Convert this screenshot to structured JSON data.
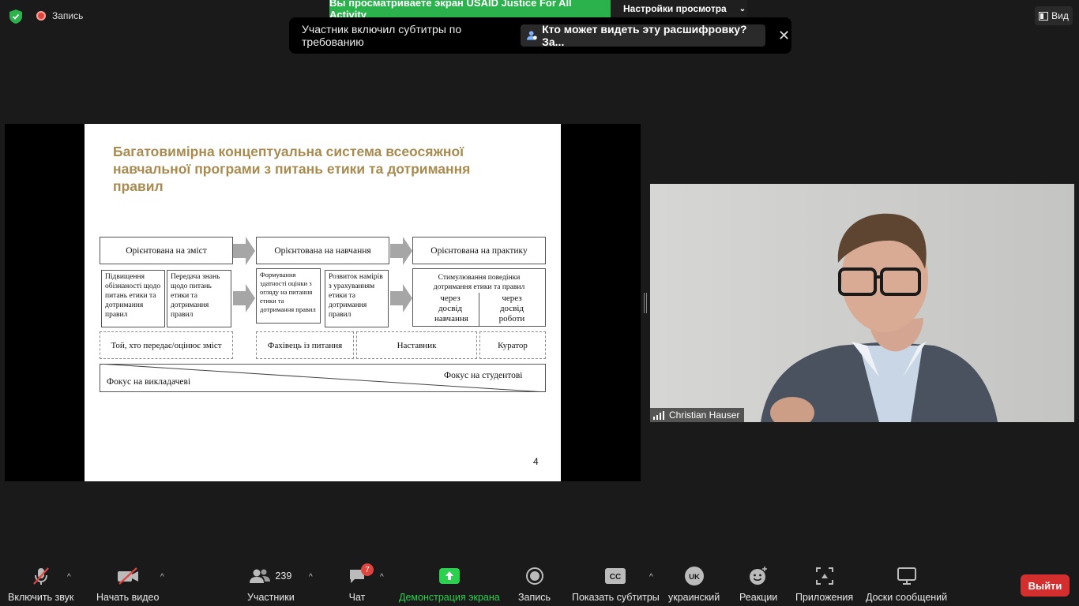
{
  "top": {
    "recording_label": "Запись",
    "share_banner": "Вы просматриваете экран USAID Justice For All Activity",
    "view_options": "Настройки просмотра",
    "view_button": "Вид"
  },
  "caption_notice": {
    "text": "Участник включил субтитры по требованию",
    "link": "Кто может видеть эту расшифровку? За..."
  },
  "slide": {
    "title": "Багатовимірна концептуальна система всеосяжної навчальної програми з питань етики та дотримання правил",
    "col1_header": "Орієнтована на  зміст",
    "col2_header": "Орієнтована на  навчання",
    "col3_header": "Орієнтована на практику",
    "box1": "Підвищення обізнаності щодо питань етики та дотримання правил",
    "box2": "Передача знань щодо питань етики та дотримання правил",
    "box3": "Формування здатності оцінки з огляду на питання етики та дотримання правил",
    "box4": "Розвиток намірів з урахуванням етики та дотримання правил",
    "box5_top": "Стимулювання поведінки дотримання етики та правил",
    "box5_left": "через досвід навчання",
    "box5_right": "через досвід роботи",
    "role1": "Той, хто передає/оцінює зміст",
    "role2": "Фахівець із питання",
    "role3": "Наставник",
    "role4": "Куратор",
    "focus_left": "Фокус на викладачеві",
    "focus_right": "Фокус на студентові",
    "page_number": "4"
  },
  "video": {
    "participant_name": "Christian Hauser"
  },
  "toolbar": {
    "mute": "Включить звук",
    "video": "Начать видео",
    "participants": "Участники",
    "participants_count": "239",
    "chat": "Чат",
    "chat_badge": "7",
    "share": "Демонстрация экрана",
    "record": "Запись",
    "captions": "Показать субтитры",
    "language": "украинский",
    "language_code": "UK",
    "reactions": "Реакции",
    "apps": "Приложения",
    "whiteboards": "Доски сообщений",
    "leave": "Выйти"
  },
  "colors": {
    "share_green": "#2bb24c",
    "leave_red": "#d32f2f",
    "slide_title": "#a78b50"
  }
}
